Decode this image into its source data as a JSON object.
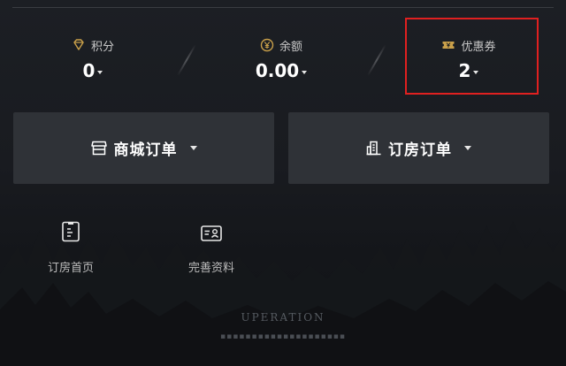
{
  "stats": [
    {
      "label": "积分",
      "value": "0",
      "icon": "diamond-icon"
    },
    {
      "label": "余额",
      "value": "0.00",
      "icon": "yen-coin-icon"
    },
    {
      "label": "优惠券",
      "value": "2",
      "icon": "coupon-icon"
    }
  ],
  "orders": {
    "mall_label": "商城订单",
    "room_label": "订房订单"
  },
  "quick_links": [
    {
      "label": "订房首页",
      "icon": "document-icon"
    },
    {
      "label": "完善资料",
      "icon": "id-card-icon"
    }
  ],
  "footer": {
    "brand": "UPERATION"
  },
  "colors": {
    "accent_gold": "#c9a04a",
    "highlight": "#e02020",
    "card_bg": "#2f3237"
  }
}
